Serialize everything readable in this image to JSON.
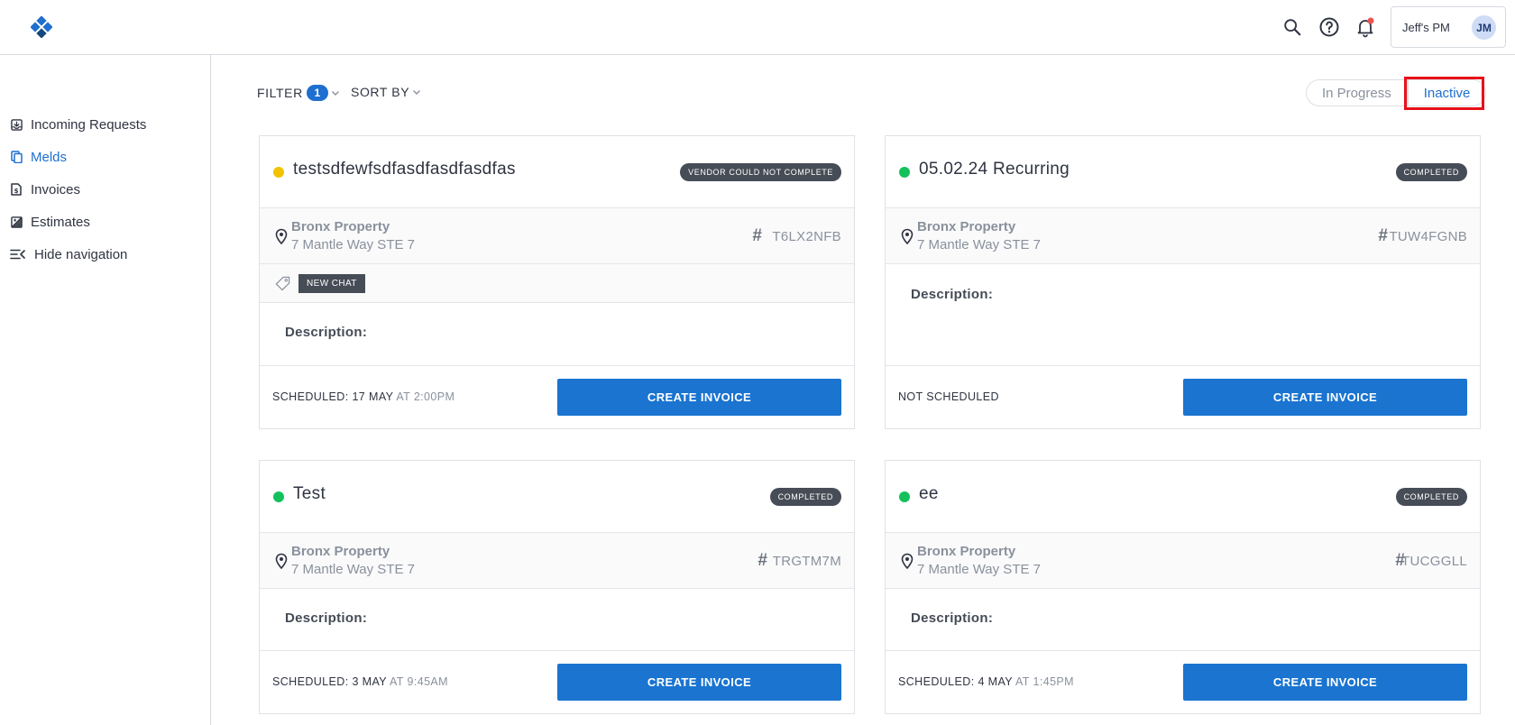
{
  "header": {
    "account_name": "Jeff's PM",
    "avatar_initials": "JM",
    "brand_color": "#1e6fd0",
    "notification_dot_color": "#ef5350"
  },
  "sidebar": {
    "items": [
      {
        "label": "Incoming Requests",
        "icon": "inbox-icon",
        "active": false
      },
      {
        "label": "Melds",
        "icon": "copy-icon",
        "active": true
      },
      {
        "label": "Invoices",
        "icon": "invoice-icon",
        "active": false
      },
      {
        "label": "Estimates",
        "icon": "estimate-icon",
        "active": false
      },
      {
        "label": "Hide navigation",
        "icon": "collapse-menu-icon",
        "active": false
      }
    ]
  },
  "controls": {
    "filter_label": "FILTER",
    "filter_count": "1",
    "sort_label": "SORT BY",
    "tabs": [
      {
        "label": "In Progress",
        "selected": false
      },
      {
        "label": "Inactive",
        "selected": true
      }
    ]
  },
  "cards": [
    {
      "title": "testsdfewfsdfasdfasdfasdfas",
      "status": "VENDOR COULD NOT COMPLETE",
      "dot_color": "#f2c200",
      "property_name": "Bronx Property",
      "address": "7 Mantle Way STE 7",
      "code": "T6LX2NFB",
      "tags": [
        "NEW CHAT"
      ],
      "description_label": "Description:",
      "schedule_prefix": "SCHEDULED: 17 MAY",
      "schedule_time": "AT 2:00PM",
      "button_label": "CREATE INVOICE"
    },
    {
      "title": "05.02.24 Recurring",
      "status": "COMPLETED",
      "dot_color": "#12c15b",
      "property_name": "Bronx Property",
      "address": "7 Mantle Way STE 7",
      "code": "TUW4FGNB",
      "tags": [],
      "description_label": "Description:",
      "schedule_prefix": "NOT SCHEDULED",
      "schedule_time": "",
      "button_label": "CREATE INVOICE"
    },
    {
      "title": "Test",
      "status": "COMPLETED",
      "dot_color": "#12c15b",
      "property_name": "Bronx Property",
      "address": "7 Mantle Way STE 7",
      "code": "TRGTM7M",
      "tags": [],
      "description_label": "Description:",
      "schedule_prefix": "SCHEDULED: 3 MAY",
      "schedule_time": "AT 9:45AM",
      "button_label": "CREATE INVOICE"
    },
    {
      "title": "ee",
      "status": "COMPLETED",
      "dot_color": "#12c15b",
      "property_name": "Bronx Property",
      "address": "7 Mantle Way STE 7",
      "code": "TUCGGLL",
      "tags": [],
      "description_label": "Description:",
      "schedule_prefix": "SCHEDULED: 4 MAY",
      "schedule_time": "AT 1:45PM",
      "button_label": "CREATE INVOICE"
    }
  ]
}
